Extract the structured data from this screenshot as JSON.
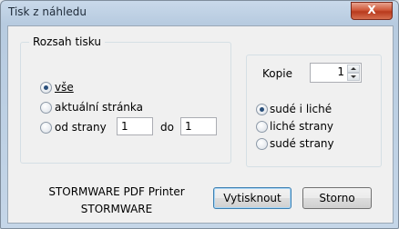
{
  "window": {
    "title": "Tisk z náhledu",
    "close_glyph": "X"
  },
  "range_group": {
    "legend": "Rozsah tisku",
    "options": [
      {
        "label": "vše",
        "checked": true
      },
      {
        "label": "aktuální stránka",
        "checked": false
      },
      {
        "label": "od strany",
        "checked": false
      }
    ],
    "from_value": "1",
    "to_label": "do",
    "to_value": "1"
  },
  "copies": {
    "label": "Kopie",
    "value": "1"
  },
  "pages_group": {
    "options": [
      {
        "label": "sudé i liché",
        "checked": true
      },
      {
        "label": "liché strany",
        "checked": false
      },
      {
        "label": "sudé strany",
        "checked": false
      }
    ]
  },
  "printer": {
    "name": "STORMWARE PDF Printer",
    "vendor": "STORMWARE"
  },
  "buttons": {
    "print": "Vytisknout",
    "cancel": "Storno"
  }
}
